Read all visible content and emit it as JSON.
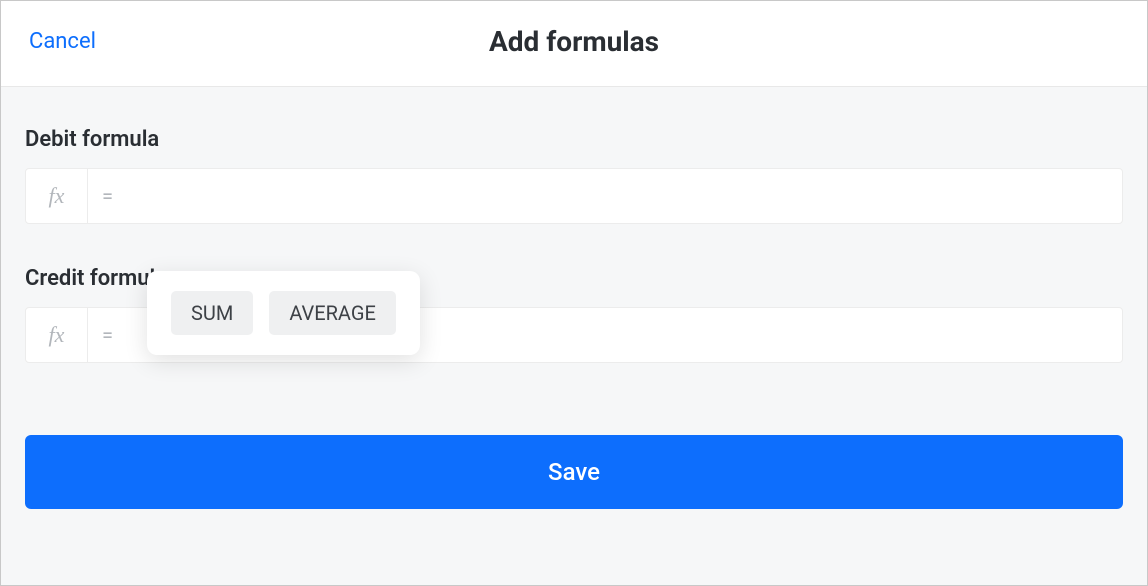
{
  "header": {
    "cancel_label": "Cancel",
    "title": "Add formulas"
  },
  "fields": {
    "debit": {
      "label": "Debit formula",
      "fx_prefix": "fx",
      "equals": "=",
      "value": ""
    },
    "credit": {
      "label": "Credit formula",
      "fx_prefix": "fx",
      "equals": "=",
      "value": ""
    }
  },
  "suggestions": {
    "sum": "SUM",
    "average": "AVERAGE"
  },
  "actions": {
    "save_label": "Save"
  }
}
